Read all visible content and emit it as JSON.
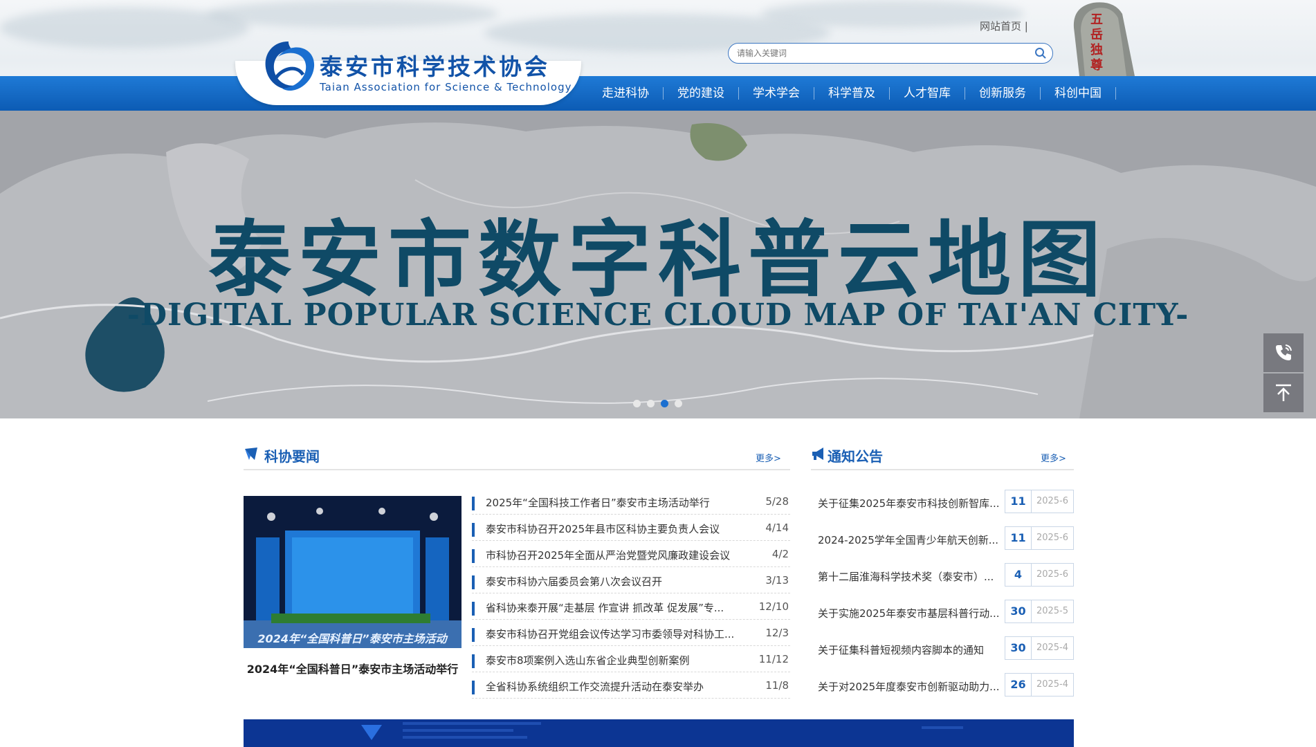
{
  "header": {
    "org_name_cn": "泰安市科学技术协会",
    "org_name_en": "Taian Association for Science & Technology",
    "home_link": "网站首页 |",
    "search_placeholder": "请输入关键词",
    "rock_text": "五岳独尊"
  },
  "nav": {
    "items": [
      "走进科协",
      "党的建设",
      "学术学会",
      "科学普及",
      "人才智库",
      "创新服务",
      "科创中国"
    ]
  },
  "banner": {
    "title": "泰安市数字科普云地图",
    "subtitle": "-DIGITAL POPULAR SCIENCE CLOUD MAP OF TAI'AN CITY-",
    "slide_count": 4,
    "active_slide": 3
  },
  "news": {
    "title": "科协要闻",
    "more": "更多>",
    "photo_banner_text": "2024年“全国科普日”泰安市主场活动",
    "photo_caption": "2024年“全国科普日”泰安市主场活动举行",
    "items": [
      {
        "title": "2025年“全国科技工作者日”泰安市主场活动举行",
        "date": "5/28"
      },
      {
        "title": "泰安市科协召开2025年县市区科协主要负责人会议",
        "date": "4/14"
      },
      {
        "title": "市科协召开2025年全面从严治党暨党风廉政建设会议",
        "date": "4/2"
      },
      {
        "title": "泰安市科协六届委员会第八次会议召开",
        "date": "3/13"
      },
      {
        "title": "省科协来泰开展“走基层 作宣讲 抓改革 促发展”专...",
        "date": "12/10"
      },
      {
        "title": "泰安市科协召开党组会议传达学习市委领导对科协工...",
        "date": "12/3"
      },
      {
        "title": "泰安市8项案例入选山东省企业典型创新案例",
        "date": "11/12"
      },
      {
        "title": "全省科协系统组织工作交流提升活动在泰安举办",
        "date": "11/8"
      }
    ]
  },
  "notices": {
    "title": "通知公告",
    "more": "更多>",
    "items": [
      {
        "title": "关于征集2025年泰安市科技创新智库...",
        "day": "11",
        "ym": "2025-6"
      },
      {
        "title": "2024-2025学年全国青少年航天创新...",
        "day": "11",
        "ym": "2025-6"
      },
      {
        "title": "第十二届淮海科学技术奖（泰安市）...",
        "day": "4",
        "ym": "2025-6"
      },
      {
        "title": "关于实施2025年泰安市基层科普行动...",
        "day": "30",
        "ym": "2025-5"
      },
      {
        "title": "关于征集科普短视频内容脚本的通知",
        "day": "30",
        "ym": "2025-4"
      },
      {
        "title": "关于对2025年度泰安市创新驱动助力...",
        "day": "26",
        "ym": "2025-4"
      }
    ]
  },
  "colors": {
    "brand_blue": "#1a5fb4",
    "nav_blue": "#0c5bb4",
    "banner_text": "#0f4a66"
  },
  "icons": [
    "search-icon",
    "phone-icon",
    "back-to-top-icon",
    "news-icon",
    "megaphone-icon"
  ]
}
